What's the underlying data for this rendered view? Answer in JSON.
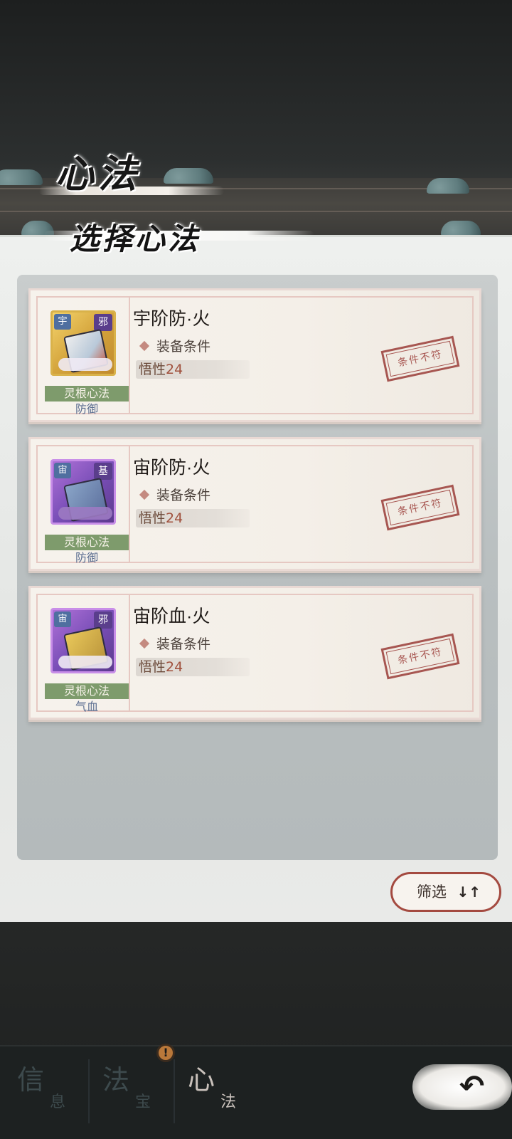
{
  "header": {
    "title": "心法",
    "subtitle": "选择心法"
  },
  "cards": [
    {
      "name": "宇阶防·火",
      "icon": "book-gold-icon",
      "tag_left": "宇",
      "tag_right": "邪",
      "type_label": "灵根心法",
      "category": "防御",
      "condition_label": "装备条件",
      "requirement_key": "悟性",
      "requirement_value": "24",
      "stamp": "条件不符"
    },
    {
      "name": "宙阶防·火",
      "icon": "book-purple-icon",
      "tag_left": "宙",
      "tag_right": "基",
      "type_label": "灵根心法",
      "category": "防御",
      "condition_label": "装备条件",
      "requirement_key": "悟性",
      "requirement_value": "24",
      "stamp": "条件不符"
    },
    {
      "name": "宙阶血·火",
      "icon": "book-purple-icon",
      "tag_left": "宙",
      "tag_right": "邪",
      "type_label": "灵根心法",
      "category": "气血",
      "condition_label": "装备条件",
      "requirement_key": "悟性",
      "requirement_value": "24",
      "stamp": "条件不符"
    }
  ],
  "filter": {
    "label": "筛选",
    "icon": "sort-arrows-icon",
    "arrows": "↓↑"
  },
  "bottom_nav": [
    {
      "big": "信",
      "small": "息",
      "active": false
    },
    {
      "big": "法",
      "small": "宝",
      "active": false,
      "alert": "!"
    },
    {
      "big": "心",
      "small": "法",
      "active": true
    }
  ],
  "back": {
    "icon": "back-arrow-icon",
    "glyph": "↶"
  },
  "colors": {
    "accent_red": "#a44a40",
    "type_green": "#7e9b6c",
    "stamp_red": "#9b3d38",
    "category_blue": "#5a6d90"
  }
}
